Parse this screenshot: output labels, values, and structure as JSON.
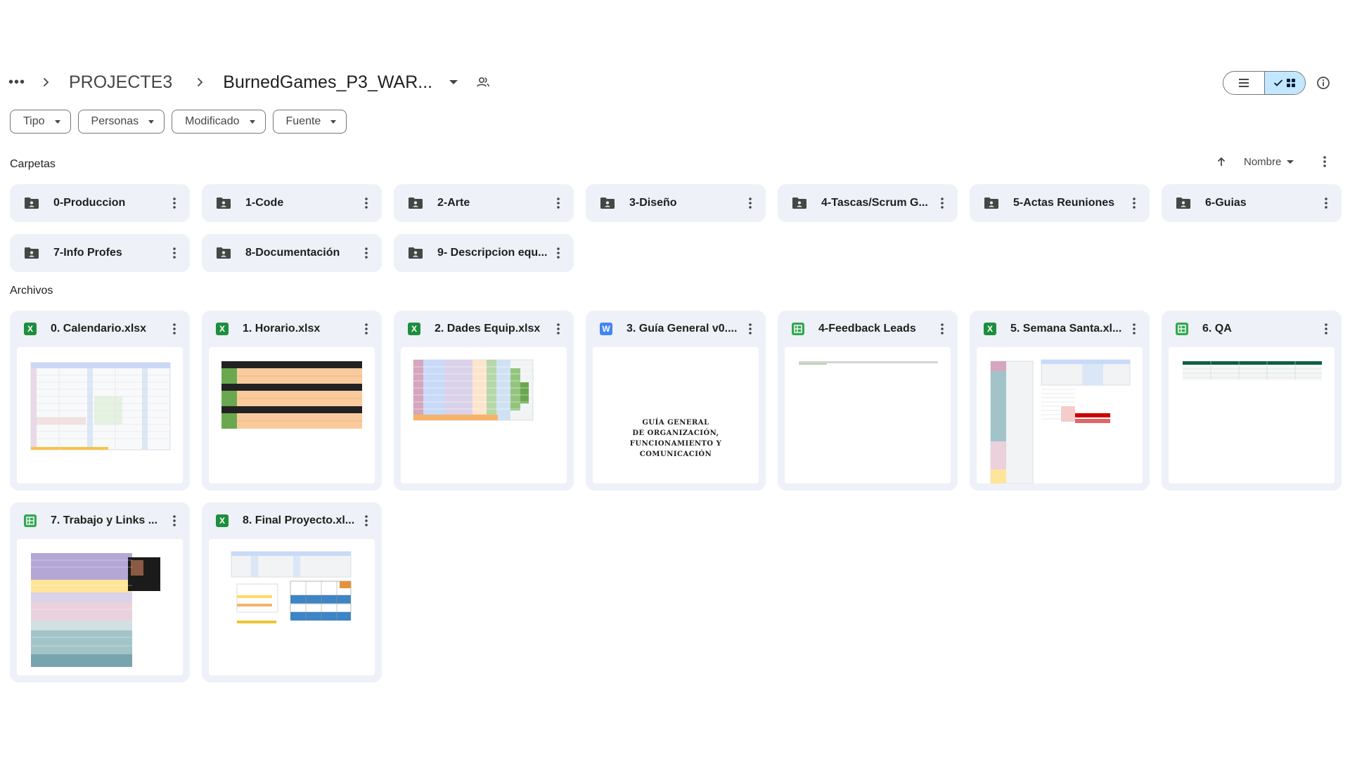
{
  "breadcrumb": {
    "more_label": "•••",
    "parent": "PROJECTE3",
    "current": "BurnedGames_P3_WAR..."
  },
  "filters": [
    "Tipo",
    "Personas",
    "Modificado",
    "Fuente"
  ],
  "sections": {
    "folders_label": "Carpetas",
    "files_label": "Archivos"
  },
  "sort": {
    "label": "Nombre"
  },
  "folders": [
    "0-Produccion",
    "1-Code",
    "2-Arte",
    "3-Diseño",
    "4-Tascas/Scrum G...",
    "5-Actas Reuniones",
    "6-Guias",
    "7-Info Profes",
    "8-Documentación",
    "9- Descripcion equ..."
  ],
  "files": [
    {
      "name": "0. Calendario.xlsx",
      "icon": "excel-icon",
      "icon_letter": "X"
    },
    {
      "name": "1. Horario.xlsx",
      "icon": "excel-icon",
      "icon_letter": "X"
    },
    {
      "name": "2. Dades Equip.xlsx",
      "icon": "excel-icon",
      "icon_letter": "X"
    },
    {
      "name": "3. Guía General v0....",
      "icon": "word-icon",
      "icon_letter": "W"
    },
    {
      "name": "4-Feedback Leads",
      "icon": "sheets-icon",
      "icon_letter": ""
    },
    {
      "name": "5. Semana Santa.xl...",
      "icon": "excel-icon",
      "icon_letter": "X"
    },
    {
      "name": "6. QA",
      "icon": "sheets-icon",
      "icon_letter": ""
    },
    {
      "name": "7. Trabajo y Links ...",
      "icon": "sheets-icon",
      "icon_letter": ""
    },
    {
      "name": "8. Final Proyecto.xl...",
      "icon": "excel-icon",
      "icon_letter": "X"
    }
  ],
  "doc_thumbnail": {
    "lines": [
      "GUÍA GENERAL",
      "DE ORGANIZACIÓN,",
      "FUNCIONAMIENTO Y",
      "COMUNICACIÓN"
    ]
  },
  "colors": {
    "card_bg": "#eef1f7",
    "toggle_active": "#c2e7ff",
    "excel": "#1e8e3e",
    "sheets": "#34a853",
    "word": "#4285f4"
  }
}
